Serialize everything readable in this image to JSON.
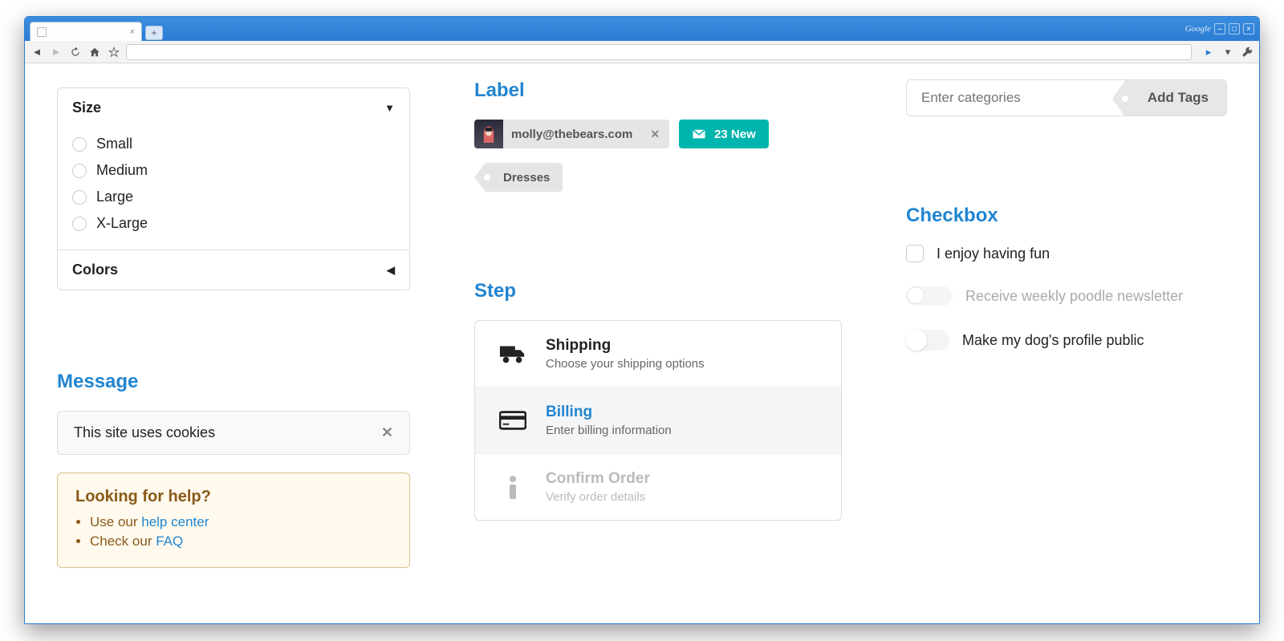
{
  "browser": {
    "tab_title": "",
    "google_logo": "Google"
  },
  "accordion": {
    "size_title": "Size",
    "size_options": [
      "Small",
      "Medium",
      "Large",
      "X-Large"
    ],
    "colors_title": "Colors"
  },
  "message": {
    "heading": "Message",
    "cookie_text": "This site uses cookies",
    "help_heading": "Looking for help?",
    "help_line1_prefix": "Use our ",
    "help_line1_link": "help center",
    "help_line2_prefix": "Check our ",
    "help_line2_link": "FAQ"
  },
  "label": {
    "heading": "Label",
    "email": "molly@thebears.com",
    "new_count": "23 New",
    "tag": "Dresses"
  },
  "step": {
    "heading": "Step",
    "items": [
      {
        "title": "Shipping",
        "desc": "Choose your shipping options"
      },
      {
        "title": "Billing",
        "desc": "Enter billing information"
      },
      {
        "title": "Confirm Order",
        "desc": "Verify order details"
      }
    ]
  },
  "tags": {
    "placeholder": "Enter categories",
    "button": "Add Tags"
  },
  "checkbox": {
    "heading": "Checkbox",
    "opt1": "I enjoy having fun",
    "opt2": "Receive weekly poodle newsletter",
    "opt3": "Make my dog's profile public"
  }
}
